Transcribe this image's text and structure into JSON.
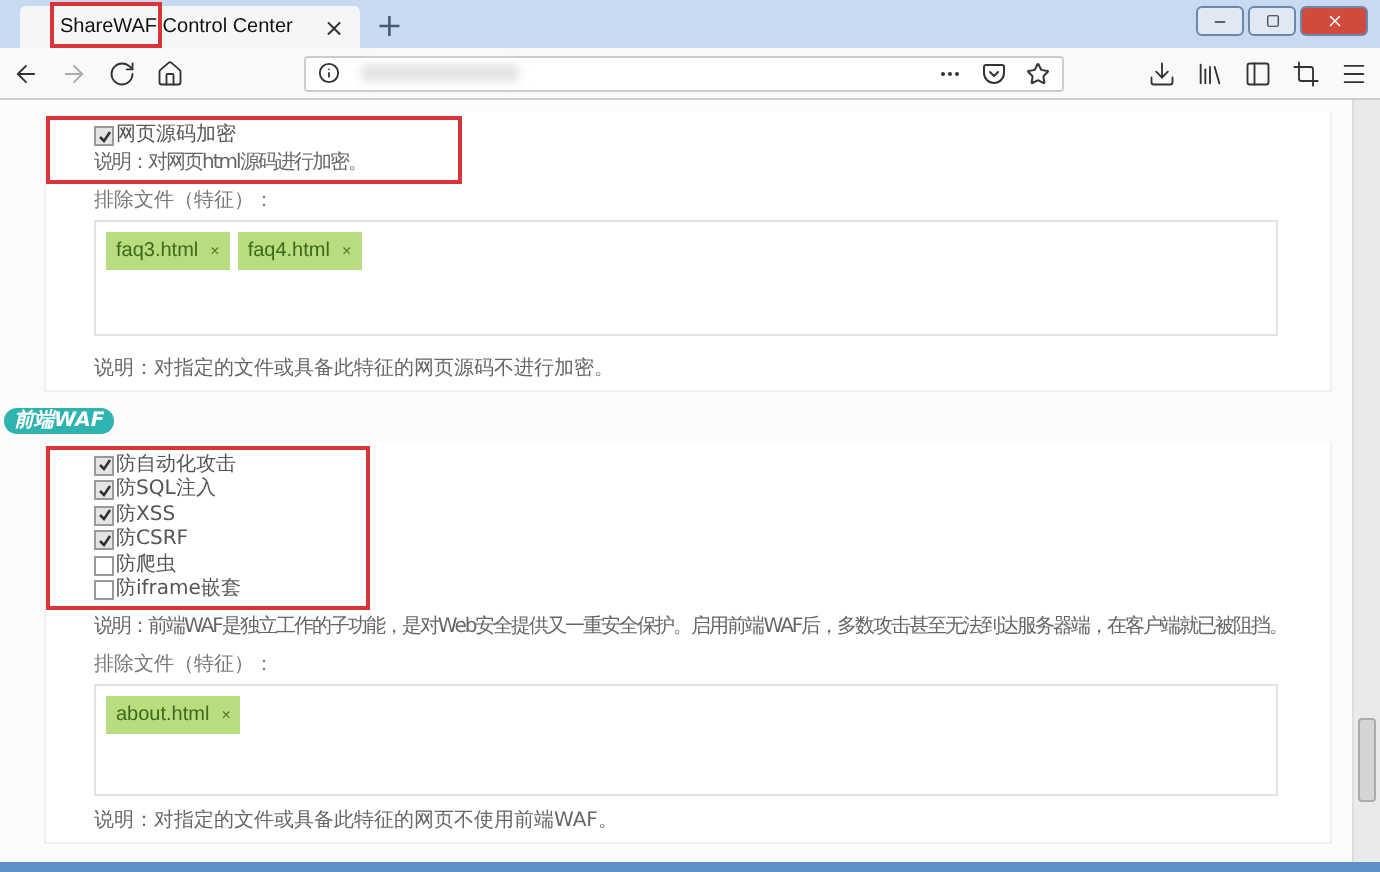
{
  "window": {
    "tab_title": "ShareWAF Control Center",
    "tab_close": "×",
    "new_tab": "+",
    "tab_annotated": true
  },
  "sections": [
    {
      "annotated": true,
      "options": [
        {
          "label": "网页源码加密",
          "checked": true
        }
      ],
      "note": "说明：对网页html源码进行加密。",
      "exclude_label": "排除文件（特征）：",
      "tags": [
        {
          "label": "faq3.html",
          "remove": "×"
        },
        {
          "label": "faq4.html",
          "remove": "×"
        }
      ],
      "footer": "说明：对指定的文件或具备此特征的网页源码不进行加密。"
    },
    {
      "badge": "前端WAF",
      "annotated": true,
      "options": [
        {
          "label": "防自动化攻击",
          "checked": true
        },
        {
          "label": "防SQL注入",
          "checked": true
        },
        {
          "label": "防XSS",
          "checked": true
        },
        {
          "label": "防CSRF",
          "checked": true
        },
        {
          "label": "防爬虫",
          "checked": false
        },
        {
          "label": "防iframe嵌套",
          "checked": false
        }
      ],
      "note": "说明：前端WAF是独立工作的子功能，是对Web安全提供又一重安全保护。启用前端WAF后，多数攻击甚至无法到达服务器端，在客户端就已被阻挡。",
      "exclude_label": "排除文件（特征）：",
      "tags": [
        {
          "label": "about.html",
          "remove": "×"
        }
      ],
      "footer": "说明：对指定的文件或具备此特征的网页不使用前端WAF。"
    }
  ]
}
